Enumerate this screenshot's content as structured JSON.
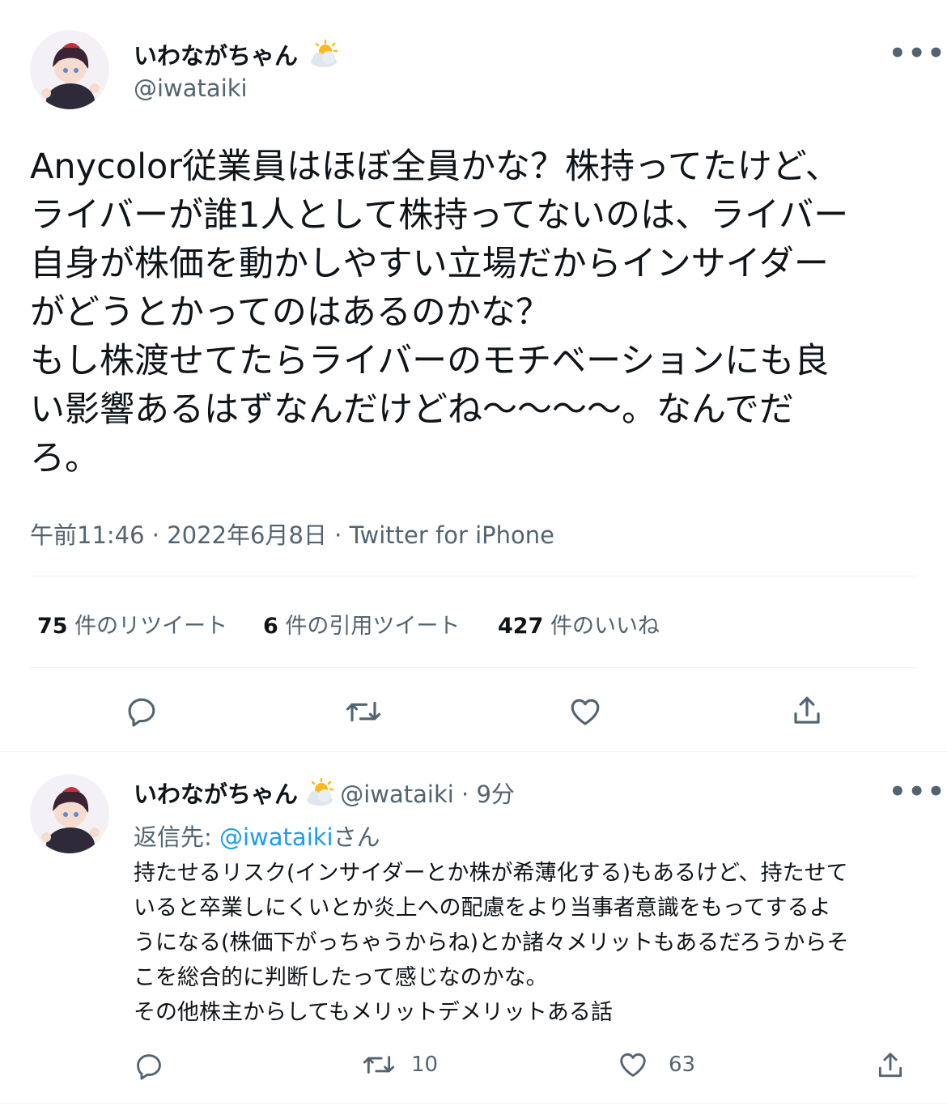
{
  "main_tweet": {
    "display_name": "いわながちゃん",
    "name_emoji": "sun-behind-cloud-icon",
    "handle": "@iwataiki",
    "more": "•••",
    "text": "Anycolor従業員はほぼ全員かな？株持ってたけど、\nライバーが誰1人として株持ってないのは、ライバー\n自身が株価を動かしやすい立場だからインサイダー\nがどうとかってのはあるのかな？\nもし株渡せてたらライバーのモチベーションにも良\nい影響あるはずなんだけどね〜〜〜〜。なんでだ\nろ。",
    "timestamp": "午前11:46 · 2022年6月8日 · ",
    "source": "Twitter for iPhone",
    "stats": {
      "retweets_count": "75",
      "retweets_label": "件のリツイート",
      "quotes_count": "6",
      "quotes_label": "件の引用ツイート",
      "likes_count": "427",
      "likes_label": "件のいいね"
    }
  },
  "reply_tweet": {
    "display_name": "いわながちゃん",
    "handle_time": "@iwataiki · 9分",
    "more": "•••",
    "replying_prefix": "返信先: ",
    "replying_handle": "@iwataiki",
    "replying_suffix": "さん",
    "text": "持たせるリスク(インサイダーとか株が希薄化する)もあるけど、持たせて\nいると卒業しにくいとか炎上への配慮をより当事者意識をもってするよ\nうになる(株価下がっちゃうからね)とか諸々メリットもあるだろうからそ\nこを総合的に判断したって感じなのかな。\nその他株主からしてもメリットデメリットある話",
    "retweet_count": "10",
    "like_count": "63"
  },
  "colors": {
    "text": "#0f1419",
    "secondary": "#536471",
    "accent": "#1d9bf0",
    "divider": "#eff3f4"
  }
}
